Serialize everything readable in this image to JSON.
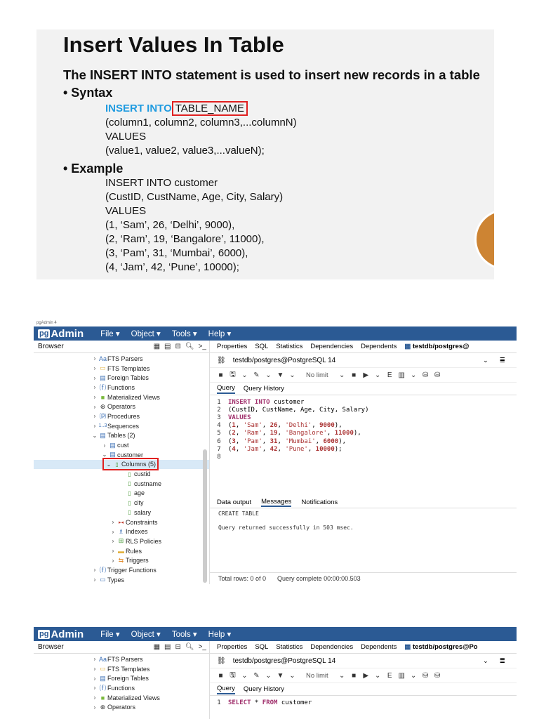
{
  "slide": {
    "title": "Insert Values In Table",
    "description": "The INSERT INTO statement is used to insert new records in a table",
    "syntax_heading": "• Syntax",
    "syntax_keyword": "INSERT INTO",
    "syntax_table": "TABLE_NAME",
    "syntax_lines": [
      "(column1, column2, column3,...columnN)",
      "VALUES",
      "(value1, value2, value3,...valueN);"
    ],
    "example_heading": "• Example",
    "example_lines": [
      "INSERT INTO customer",
      "(CustID, CustName, Age, City, Salary)",
      "VALUES",
      "(1, ‘Sam’, 26, ‘Delhi’, 9000),",
      "(2, ‘Ram’, 19, ‘Bangalore’, 11000),",
      "(3, ‘Pam’, 31, ‘Mumbai’, 6000),",
      "(4, ‘Jam’, 42, ‘Pune’, 10000);"
    ]
  },
  "pgadmin": {
    "window_title": "pgAdmin 4",
    "logo_box": "pg",
    "logo_text": "Admin",
    "menu": [
      "File ▾",
      "Object ▾",
      "Tools ▾",
      "Help ▾"
    ],
    "browser_label": "Browser",
    "tabs_top": [
      "Properties",
      "SQL",
      "Statistics",
      "Dependencies",
      "Dependents",
      "testdb/postgres@"
    ],
    "tabs_top_2_last": "testdb/postgres@Po",
    "connection": "testdb/postgres@PostgreSQL 14",
    "no_limit": "No limit",
    "query_tabs": [
      "Query",
      "Query History"
    ],
    "output_tabs": [
      "Data output",
      "Messages",
      "Notifications"
    ],
    "message_line1": "CREATE TABLE",
    "message_line2": "Query returned successfully in 503 msec.",
    "status_rows": "Total rows: 0 of 0",
    "status_complete": "Query complete 00:00:00.503",
    "tree": [
      {
        "label": "FTS Parsers",
        "icon": "Aa"
      },
      {
        "label": "FTS Templates",
        "icon": "folder"
      },
      {
        "label": "Foreign Tables",
        "icon": "table"
      },
      {
        "label": "Functions",
        "icon": "fn"
      },
      {
        "label": "Materialized Views",
        "icon": "mview"
      },
      {
        "label": "Operators",
        "icon": "operator"
      },
      {
        "label": "Procedures",
        "icon": "proc"
      },
      {
        "label": "Sequences",
        "icon": "1..3"
      },
      {
        "label": "Tables (2)",
        "icon": "table"
      },
      {
        "label": "cust",
        "icon": "table"
      },
      {
        "label": "customer",
        "icon": "table"
      },
      {
        "label": "Columns (5)",
        "icon": "columns"
      },
      {
        "label": "custid",
        "icon": "column"
      },
      {
        "label": "custname",
        "icon": "column"
      },
      {
        "label": "age",
        "icon": "column"
      },
      {
        "label": "city",
        "icon": "column"
      },
      {
        "label": "salary",
        "icon": "column"
      },
      {
        "label": "Constraints",
        "icon": "constraint"
      },
      {
        "label": "Indexes",
        "icon": "index"
      },
      {
        "label": "RLS Policies",
        "icon": "policy"
      },
      {
        "label": "Rules",
        "icon": "rule"
      },
      {
        "label": "Triggers",
        "icon": "trigger"
      },
      {
        "label": "Trigger Functions",
        "icon": "fn"
      },
      {
        "label": "Types",
        "icon": "type"
      }
    ],
    "tree_2": [
      {
        "label": "FTS Parsers"
      },
      {
        "label": "FTS Templates"
      },
      {
        "label": "Foreign Tables"
      },
      {
        "label": "Functions"
      },
      {
        "label": "Materialized Views"
      },
      {
        "label": "Operators"
      }
    ],
    "line_numbers": [
      "1",
      "2",
      "3",
      "4",
      "5",
      "6",
      "7",
      "8"
    ],
    "editor_2_line": "SELECT * FROM customer",
    "editor_2_kw1": "SELECT",
    "editor_2_mid": " * ",
    "editor_2_kw2": "FROM",
    "editor_2_rest": " customer"
  }
}
